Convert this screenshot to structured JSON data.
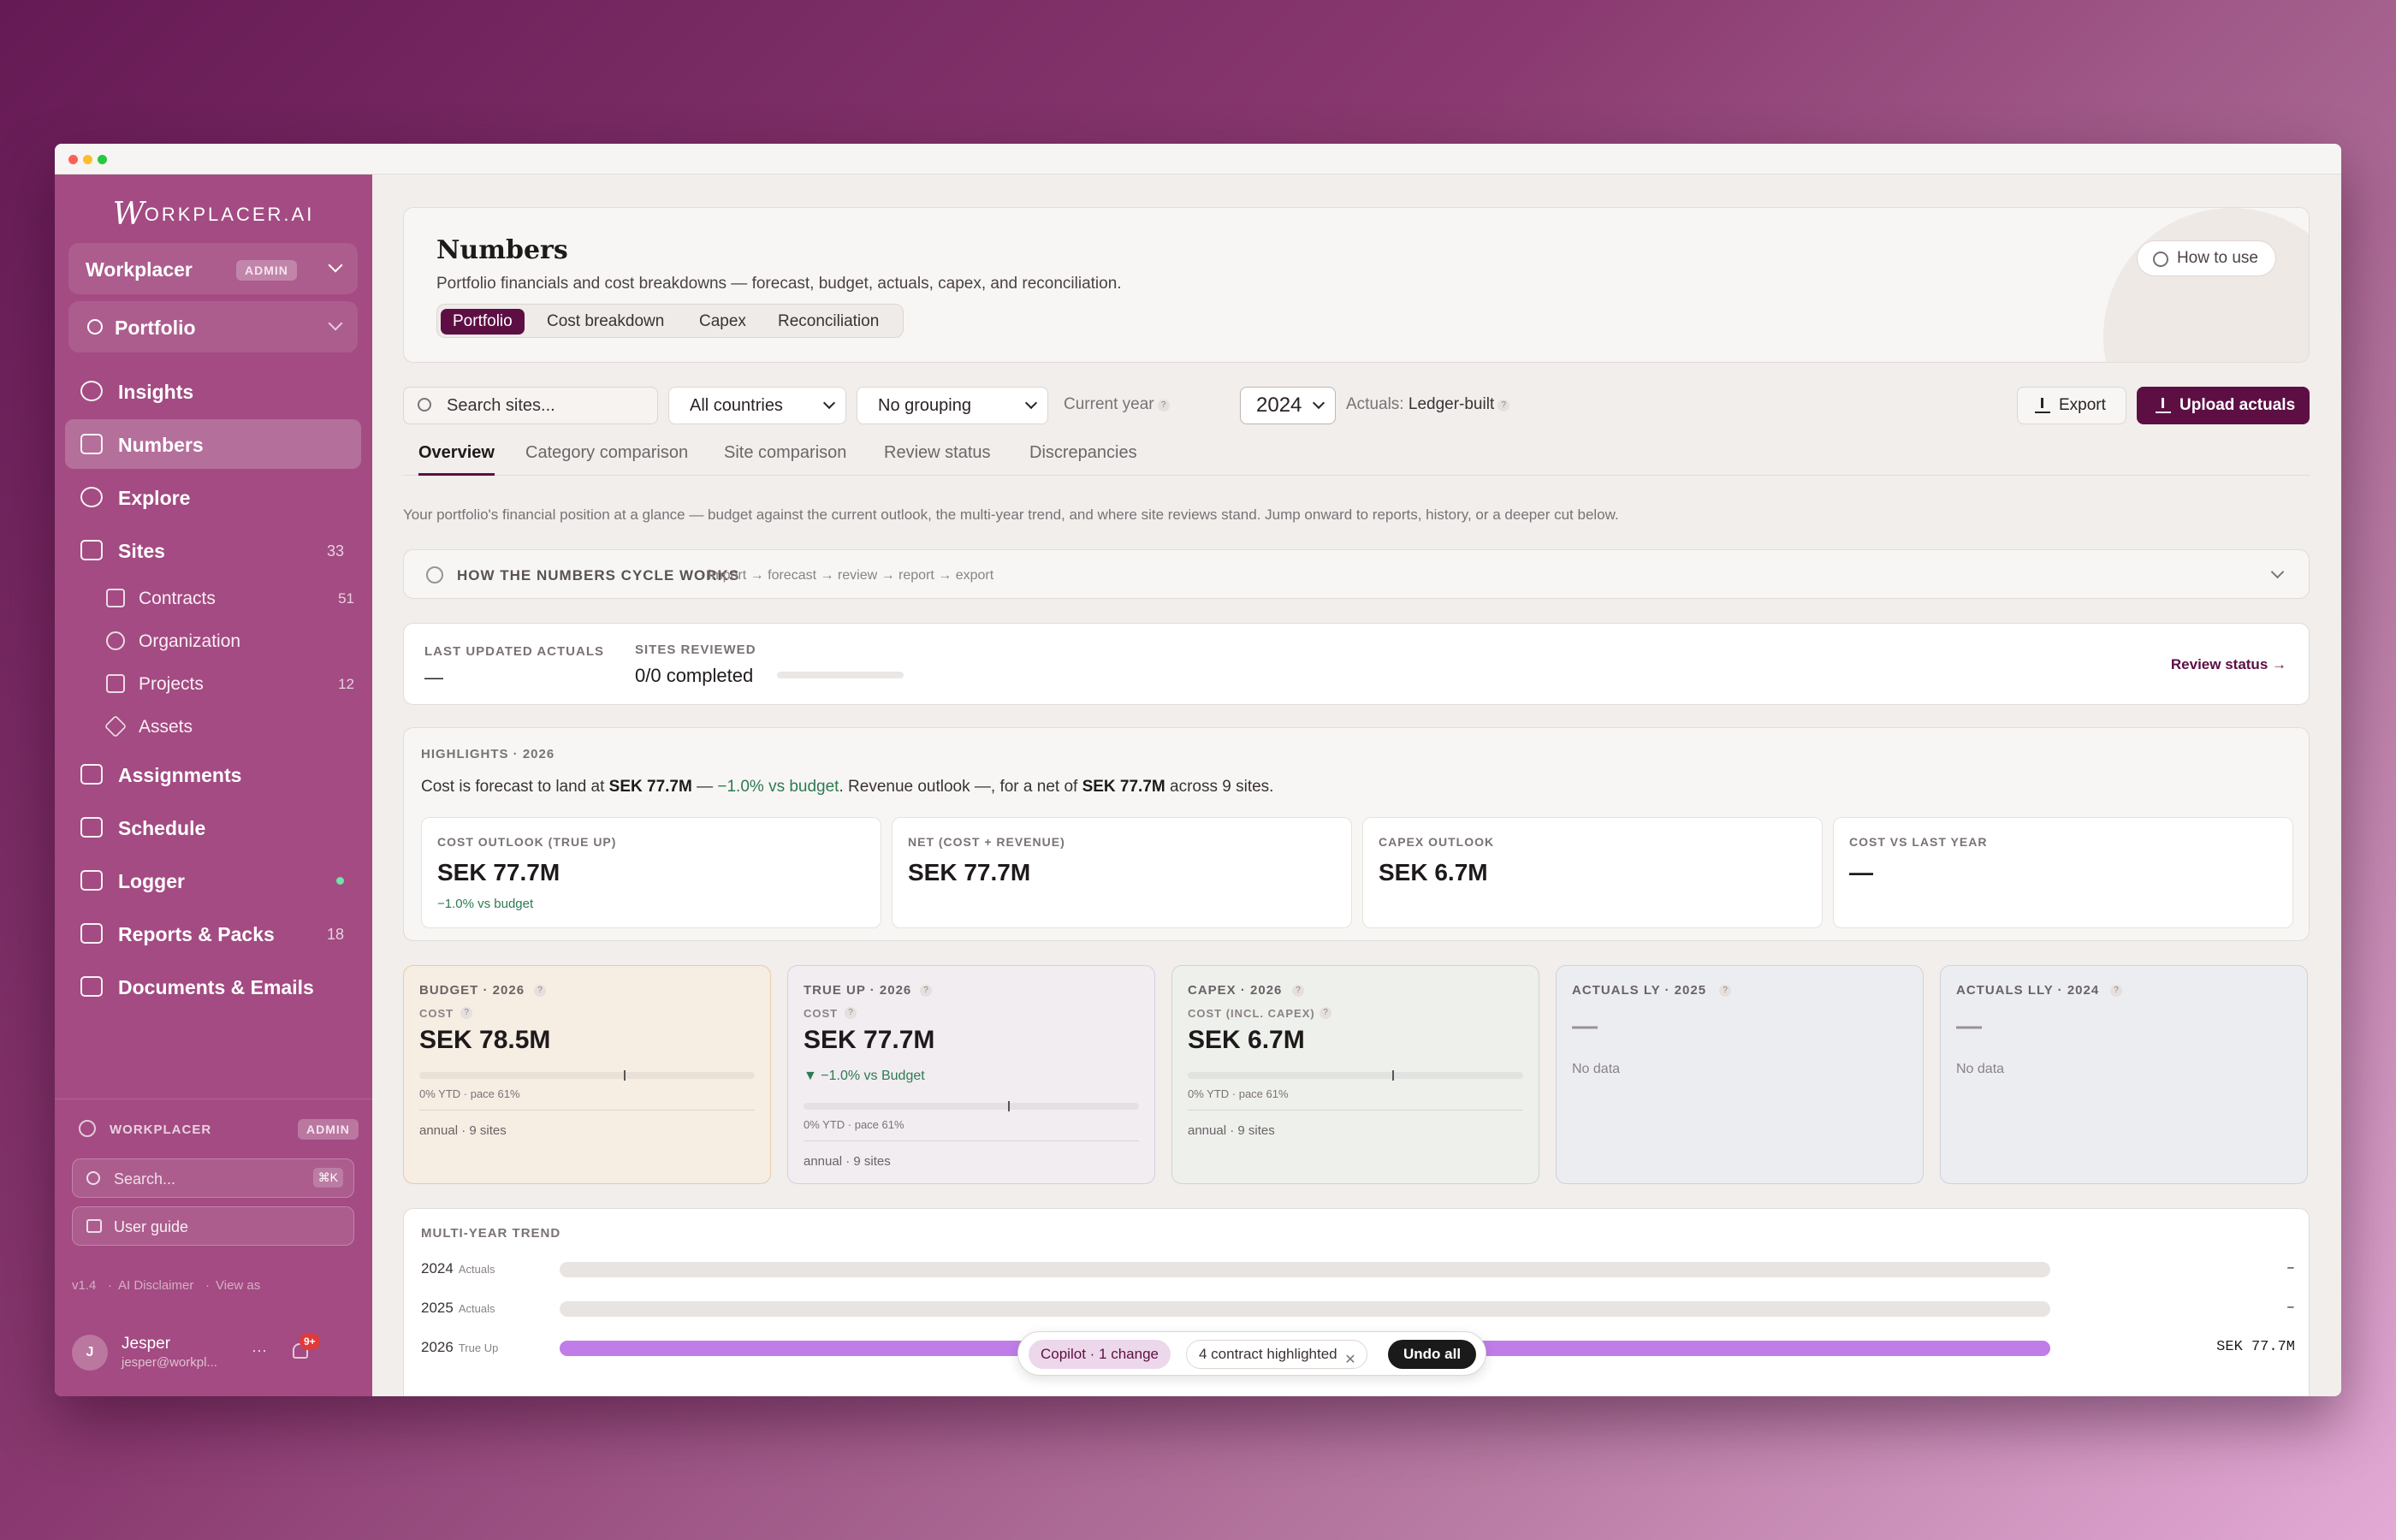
{
  "app": {
    "logo_initial": "W",
    "logo_text": "ORKPLACER.AI"
  },
  "sidebar": {
    "workspace": {
      "name": "Workplacer",
      "badge": "ADMIN"
    },
    "portfolio": {
      "label": "Portfolio"
    },
    "items": [
      {
        "label": "Insights",
        "count": "",
        "icon": "lightbulb-icon"
      },
      {
        "label": "Numbers",
        "count": "",
        "icon": "bar-chart-icon",
        "active": true
      },
      {
        "label": "Explore",
        "count": "",
        "icon": "compass-icon"
      },
      {
        "label": "Sites",
        "count": "33",
        "icon": "building-icon"
      },
      {
        "label": "Assignments",
        "count": "",
        "icon": "inbox-icon"
      },
      {
        "label": "Schedule",
        "count": "",
        "icon": "calendar-icon"
      },
      {
        "label": "Logger",
        "count": "",
        "icon": "clipboard-icon"
      },
      {
        "label": "Reports & Packs",
        "count": "18",
        "icon": "report-icon"
      },
      {
        "label": "Documents & Emails",
        "count": "",
        "icon": "book-icon"
      }
    ],
    "sub_items": [
      {
        "label": "Contracts",
        "count": "51",
        "icon": "document-icon"
      },
      {
        "label": "Organization",
        "count": "",
        "icon": "people-icon"
      },
      {
        "label": "Projects",
        "count": "12",
        "icon": "folder-icon"
      },
      {
        "label": "Assets",
        "count": "",
        "icon": "cube-icon"
      }
    ],
    "footer": {
      "org_label": "WORKPLACER",
      "org_badge": "ADMIN",
      "search_placeholder": "Search...",
      "search_shortcut": "⌘K",
      "user_guide": "User guide",
      "version": "v1.4",
      "disclaimer": "AI Disclaimer",
      "view_as": "View as",
      "user_name": "Jesper",
      "user_email": "jesper@workpl...",
      "user_initial": "J",
      "more": "···",
      "notif_count": "9+"
    }
  },
  "header": {
    "title": "Numbers",
    "subtitle": "Portfolio financials and cost breakdowns — forecast, budget, actuals, capex, and reconciliation.",
    "segments": [
      "Portfolio",
      "Cost breakdown",
      "Capex",
      "Reconciliation"
    ],
    "how_to_use": "How to use"
  },
  "controls": {
    "search_placeholder": "Search sites...",
    "country": "All countries",
    "grouping": "No grouping",
    "current_year_label": "Current year",
    "year": "2024",
    "actuals_prefix": "Actuals:",
    "actuals_value": "Ledger-built",
    "export": "Export",
    "upload": "Upload actuals"
  },
  "tabs": [
    "Overview",
    "Category comparison",
    "Site comparison",
    "Review status",
    "Discrepancies"
  ],
  "description": "Your portfolio's financial position at a glance — budget against the current outlook, the multi-year trend, and where site reviews stand. Jump onward to reports, history, or a deeper cut below.",
  "cycle": {
    "title": "HOW THE NUMBERS CYCLE WORKS",
    "steps": "· import → forecast → review → report → export"
  },
  "status": {
    "last_updated_label": "LAST UPDATED ACTUALS",
    "last_updated_value": "—",
    "reviewed_label": "SITES REVIEWED",
    "reviewed_value": "0/0 completed",
    "reviewed_progress": 0,
    "link": "Review status →"
  },
  "highlights": {
    "label": "HIGHLIGHTS · 2026",
    "text_1": "Cost is forecast to land at ",
    "text_2": "SEK 77.7M",
    "text_3": " — ",
    "text_4": "−1.0% vs budget",
    "text_5": ". Revenue outlook —, for a net of ",
    "text_6": "SEK 77.7M",
    "text_7": " across 9 sites.",
    "cards": [
      {
        "label": "COST OUTLOOK (TRUE UP)",
        "value": "SEK 77.7M",
        "sub": "−1.0% vs budget"
      },
      {
        "label": "NET (COST + REVENUE)",
        "value": "SEK 77.7M",
        "sub": ""
      },
      {
        "label": "CAPEX OUTLOOK",
        "value": "SEK 6.7M",
        "sub": ""
      },
      {
        "label": "COST VS LAST YEAR",
        "value": "—",
        "sub": ""
      }
    ]
  },
  "kpis": [
    {
      "label": "BUDGET · 2026",
      "cost": "COST",
      "value": "SEK 78.5M",
      "delta": "",
      "pace": "0% YTD · pace 61%",
      "annual": "annual · 9 sites",
      "pace_pct": 61,
      "bg": "#f6ede3",
      "border": "#e6cda8"
    },
    {
      "label": "TRUE UP · 2026",
      "cost": "COST",
      "value": "SEK 77.7M",
      "delta": "▼ −1.0% vs Budget",
      "pace": "0% YTD · pace 61%",
      "annual": "annual · 9 sites",
      "pace_pct": 61,
      "bg": "#f1edf1",
      "border": "#d8cde4"
    },
    {
      "label": "CAPEX · 2026",
      "cost": "COST (INCL. CAPEX)",
      "value": "SEK 6.7M",
      "delta": "",
      "pace": "0% YTD · pace 61%",
      "annual": "annual · 9 sites",
      "pace_pct": 61,
      "bg": "#eef0ec",
      "border": "#cfd6cc"
    },
    {
      "label": "ACTUALS LY · 2025",
      "cost": "",
      "value": "—",
      "nodata": "No data",
      "bg": "#ecedf0",
      "border": "#cfd2d9"
    },
    {
      "label": "ACTUALS LLY · 2024",
      "cost": "",
      "value": "—",
      "nodata": "No data",
      "bg": "#ecedf0",
      "border": "#cfd2d9"
    }
  ],
  "trend": {
    "label": "MULTI-YEAR TREND",
    "rows": [
      {
        "year": "2024",
        "kind": "Actuals",
        "value": "–",
        "fill": 0
      },
      {
        "year": "2025",
        "kind": "Actuals",
        "value": "–",
        "fill": 0
      },
      {
        "year": "2026",
        "kind": "True Up",
        "value": "SEK 77.7M",
        "fill": 1
      }
    ],
    "fill_color": "#c07de8"
  },
  "copilot": {
    "label": "Copilot · 1 change",
    "highlight": "4 contract highlighted",
    "undo": "Undo all"
  }
}
